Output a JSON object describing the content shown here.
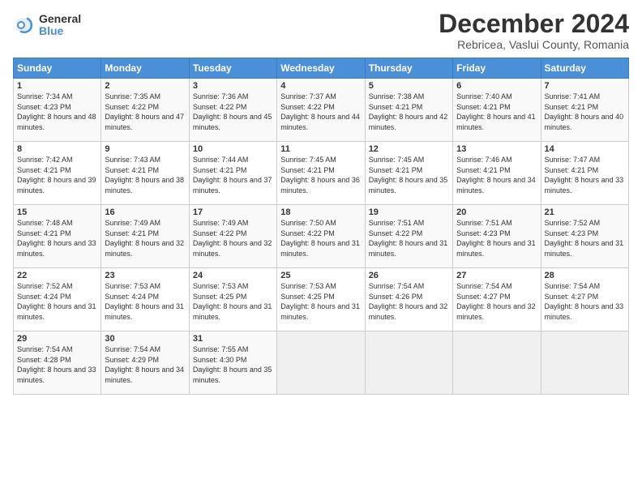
{
  "logo": {
    "general": "General",
    "blue": "Blue"
  },
  "title": "December 2024",
  "location": "Rebricea, Vaslui County, Romania",
  "days_of_week": [
    "Sunday",
    "Monday",
    "Tuesday",
    "Wednesday",
    "Thursday",
    "Friday",
    "Saturday"
  ],
  "weeks": [
    [
      {
        "day": "1",
        "sunrise": "7:34 AM",
        "sunset": "4:23 PM",
        "daylight": "8 hours and 48 minutes."
      },
      {
        "day": "2",
        "sunrise": "7:35 AM",
        "sunset": "4:22 PM",
        "daylight": "8 hours and 47 minutes."
      },
      {
        "day": "3",
        "sunrise": "7:36 AM",
        "sunset": "4:22 PM",
        "daylight": "8 hours and 45 minutes."
      },
      {
        "day": "4",
        "sunrise": "7:37 AM",
        "sunset": "4:22 PM",
        "daylight": "8 hours and 44 minutes."
      },
      {
        "day": "5",
        "sunrise": "7:38 AM",
        "sunset": "4:21 PM",
        "daylight": "8 hours and 42 minutes."
      },
      {
        "day": "6",
        "sunrise": "7:40 AM",
        "sunset": "4:21 PM",
        "daylight": "8 hours and 41 minutes."
      },
      {
        "day": "7",
        "sunrise": "7:41 AM",
        "sunset": "4:21 PM",
        "daylight": "8 hours and 40 minutes."
      }
    ],
    [
      {
        "day": "8",
        "sunrise": "7:42 AM",
        "sunset": "4:21 PM",
        "daylight": "8 hours and 39 minutes."
      },
      {
        "day": "9",
        "sunrise": "7:43 AM",
        "sunset": "4:21 PM",
        "daylight": "8 hours and 38 minutes."
      },
      {
        "day": "10",
        "sunrise": "7:44 AM",
        "sunset": "4:21 PM",
        "daylight": "8 hours and 37 minutes."
      },
      {
        "day": "11",
        "sunrise": "7:45 AM",
        "sunset": "4:21 PM",
        "daylight": "8 hours and 36 minutes."
      },
      {
        "day": "12",
        "sunrise": "7:45 AM",
        "sunset": "4:21 PM",
        "daylight": "8 hours and 35 minutes."
      },
      {
        "day": "13",
        "sunrise": "7:46 AM",
        "sunset": "4:21 PM",
        "daylight": "8 hours and 34 minutes."
      },
      {
        "day": "14",
        "sunrise": "7:47 AM",
        "sunset": "4:21 PM",
        "daylight": "8 hours and 33 minutes."
      }
    ],
    [
      {
        "day": "15",
        "sunrise": "7:48 AM",
        "sunset": "4:21 PM",
        "daylight": "8 hours and 33 minutes."
      },
      {
        "day": "16",
        "sunrise": "7:49 AM",
        "sunset": "4:21 PM",
        "daylight": "8 hours and 32 minutes."
      },
      {
        "day": "17",
        "sunrise": "7:49 AM",
        "sunset": "4:22 PM",
        "daylight": "8 hours and 32 minutes."
      },
      {
        "day": "18",
        "sunrise": "7:50 AM",
        "sunset": "4:22 PM",
        "daylight": "8 hours and 31 minutes."
      },
      {
        "day": "19",
        "sunrise": "7:51 AM",
        "sunset": "4:22 PM",
        "daylight": "8 hours and 31 minutes."
      },
      {
        "day": "20",
        "sunrise": "7:51 AM",
        "sunset": "4:23 PM",
        "daylight": "8 hours and 31 minutes."
      },
      {
        "day": "21",
        "sunrise": "7:52 AM",
        "sunset": "4:23 PM",
        "daylight": "8 hours and 31 minutes."
      }
    ],
    [
      {
        "day": "22",
        "sunrise": "7:52 AM",
        "sunset": "4:24 PM",
        "daylight": "8 hours and 31 minutes."
      },
      {
        "day": "23",
        "sunrise": "7:53 AM",
        "sunset": "4:24 PM",
        "daylight": "8 hours and 31 minutes."
      },
      {
        "day": "24",
        "sunrise": "7:53 AM",
        "sunset": "4:25 PM",
        "daylight": "8 hours and 31 minutes."
      },
      {
        "day": "25",
        "sunrise": "7:53 AM",
        "sunset": "4:25 PM",
        "daylight": "8 hours and 31 minutes."
      },
      {
        "day": "26",
        "sunrise": "7:54 AM",
        "sunset": "4:26 PM",
        "daylight": "8 hours and 32 minutes."
      },
      {
        "day": "27",
        "sunrise": "7:54 AM",
        "sunset": "4:27 PM",
        "daylight": "8 hours and 32 minutes."
      },
      {
        "day": "28",
        "sunrise": "7:54 AM",
        "sunset": "4:27 PM",
        "daylight": "8 hours and 33 minutes."
      }
    ],
    [
      {
        "day": "29",
        "sunrise": "7:54 AM",
        "sunset": "4:28 PM",
        "daylight": "8 hours and 33 minutes."
      },
      {
        "day": "30",
        "sunrise": "7:54 AM",
        "sunset": "4:29 PM",
        "daylight": "8 hours and 34 minutes."
      },
      {
        "day": "31",
        "sunrise": "7:55 AM",
        "sunset": "4:30 PM",
        "daylight": "8 hours and 35 minutes."
      },
      null,
      null,
      null,
      null
    ]
  ]
}
